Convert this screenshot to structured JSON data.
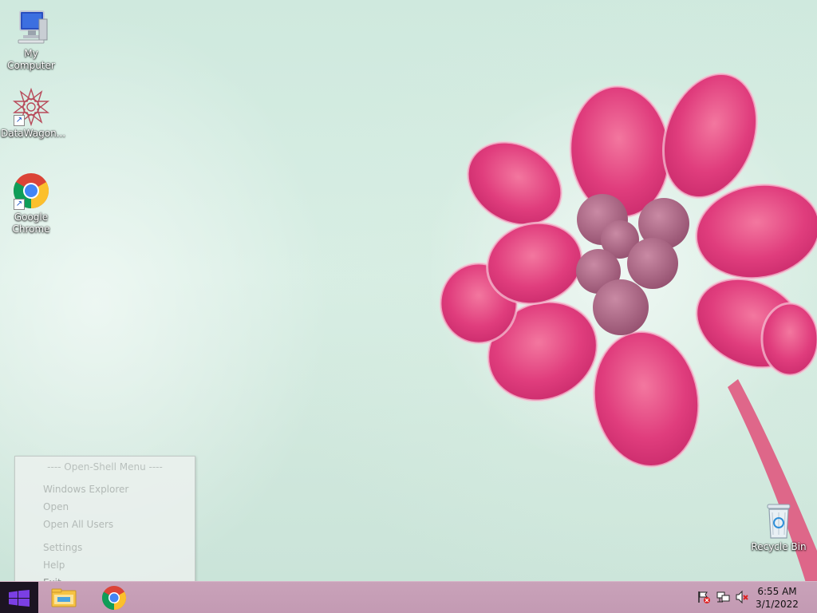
{
  "desktop": {
    "icons": [
      {
        "label": "My Computer",
        "icon": "computer-icon"
      },
      {
        "label": "DataWagon...",
        "icon": "datawagon-icon"
      },
      {
        "label": "Google Chrome",
        "label_line1": "Google",
        "label_line2": "Chrome",
        "icon": "chrome-icon"
      },
      {
        "label": "Recycle Bin",
        "icon": "recycle-bin-icon"
      }
    ]
  },
  "start_menu": {
    "header": "---- Open-Shell Menu ----",
    "items": [
      "Windows Explorer",
      "Open",
      "Open All Users",
      "Settings",
      "Help",
      "Exit"
    ]
  },
  "taskbar": {
    "apps": [
      {
        "name": "File Explorer",
        "icon": "folder-icon"
      },
      {
        "name": "Google Chrome",
        "icon": "chrome-icon"
      }
    ],
    "tray": [
      "action-center-flag-icon",
      "network-icon",
      "volume-muted-icon"
    ],
    "clock": {
      "time": "6:55 AM",
      "date": "3/1/2022"
    }
  },
  "colors": {
    "taskbar": "#c39ab3",
    "start_button": "#1c1422",
    "windows_logo": "#7b3fe4",
    "flower_pink": "#e0397a"
  }
}
